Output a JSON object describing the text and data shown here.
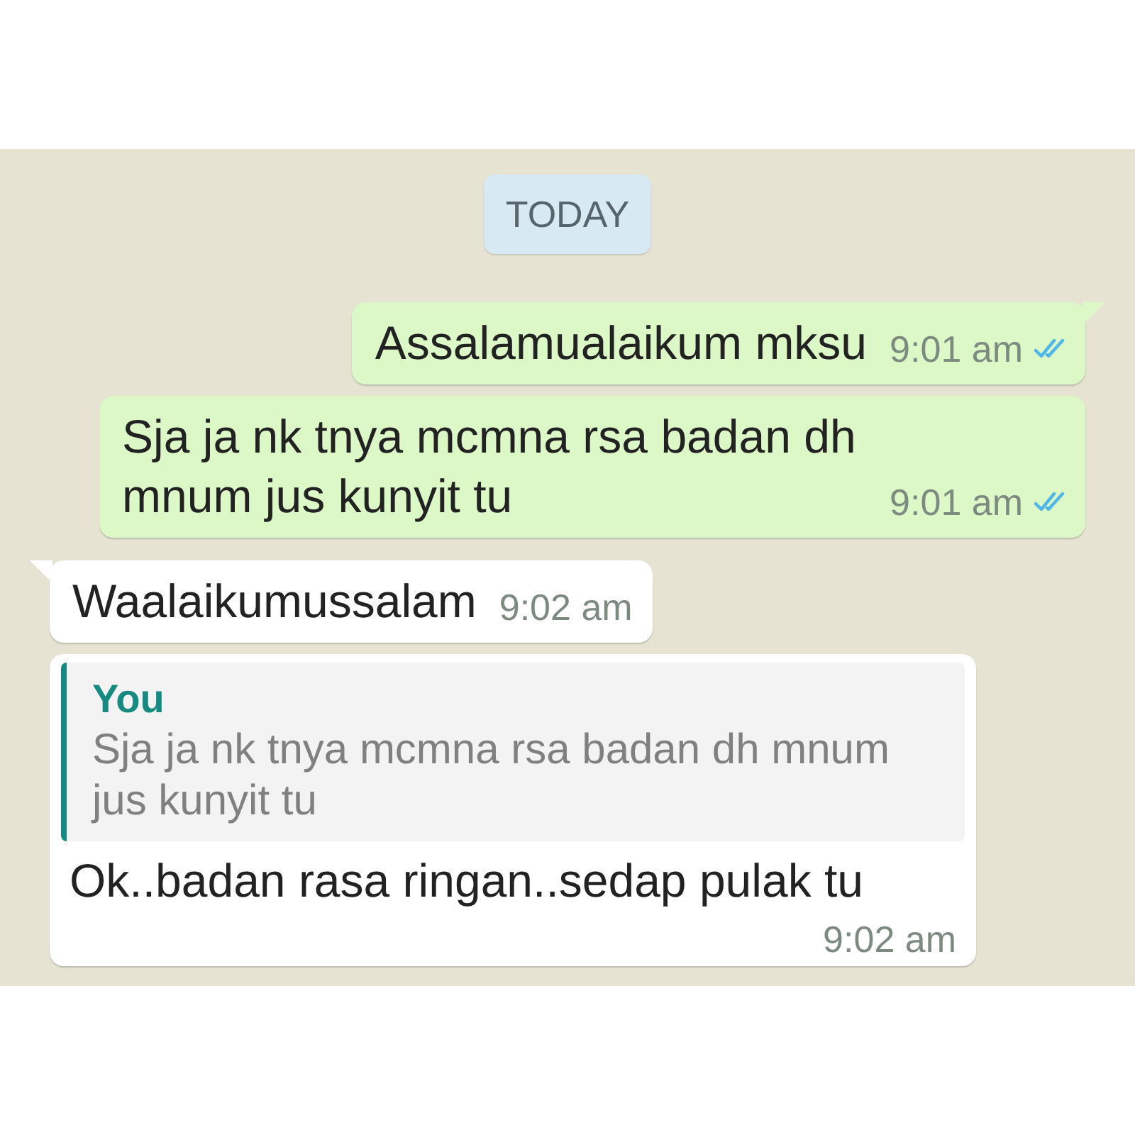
{
  "date_chip": "TODAY",
  "messages": [
    {
      "kind": "out",
      "tail": true,
      "text": "Assalamualaikum mksu",
      "time": "9:01 am",
      "read": true
    },
    {
      "kind": "out",
      "tail": false,
      "text": "Sja ja nk tnya mcmna rsa badan dh mnum jus kunyit tu",
      "time": "9:01 am",
      "read": true
    },
    {
      "kind": "in",
      "tail": true,
      "text": "Waalaikumussalam",
      "time": "9:02 am"
    },
    {
      "kind": "in",
      "tail": false,
      "quote": {
        "author": "You",
        "text": "Sja ja nk tnya mcmna rsa badan dh mnum jus kunyit tu"
      },
      "text": "Ok..badan rasa ringan..sedap pulak tu",
      "time": "9:02 am"
    }
  ]
}
